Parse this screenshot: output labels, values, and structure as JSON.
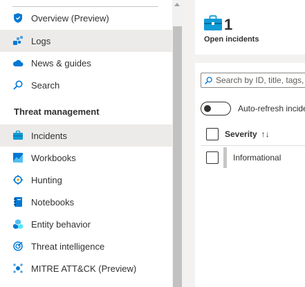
{
  "sidebar": {
    "items_top": [
      {
        "label": "Overview (Preview)",
        "icon": "shield-icon"
      },
      {
        "label": "Logs",
        "icon": "logs-icon"
      },
      {
        "label": "News & guides",
        "icon": "cloud-icon"
      },
      {
        "label": "Search",
        "icon": "search-icon"
      }
    ],
    "section_title": "Threat management",
    "items_threat": [
      {
        "label": "Incidents",
        "icon": "briefcase-icon",
        "selected": true
      },
      {
        "label": "Workbooks",
        "icon": "workbook-icon"
      },
      {
        "label": "Hunting",
        "icon": "target-icon"
      },
      {
        "label": "Notebooks",
        "icon": "notebook-icon"
      },
      {
        "label": "Entity behavior",
        "icon": "entity-behavior-icon"
      },
      {
        "label": "Threat intelligence",
        "icon": "threat-intelligence-icon"
      },
      {
        "label": "MITRE ATT&CK (Preview)",
        "icon": "mitre-icon"
      }
    ]
  },
  "summary": {
    "count": "1",
    "label": "Open incidents"
  },
  "search": {
    "placeholder": "Search by ID, title, tags, owner or product"
  },
  "auto_refresh": {
    "label": "Auto-refresh incidents",
    "on": false
  },
  "table": {
    "columns": [
      {
        "label": "Severity",
        "sort_icon": "↑↓"
      }
    ],
    "rows": [
      {
        "severity": "Informational"
      }
    ]
  },
  "colors": {
    "selected_bg": "#edebe9",
    "main_bg": "#f3f2f1",
    "accent_blue": "#0078d4",
    "briefcase_teal": "#0f9bd7"
  }
}
